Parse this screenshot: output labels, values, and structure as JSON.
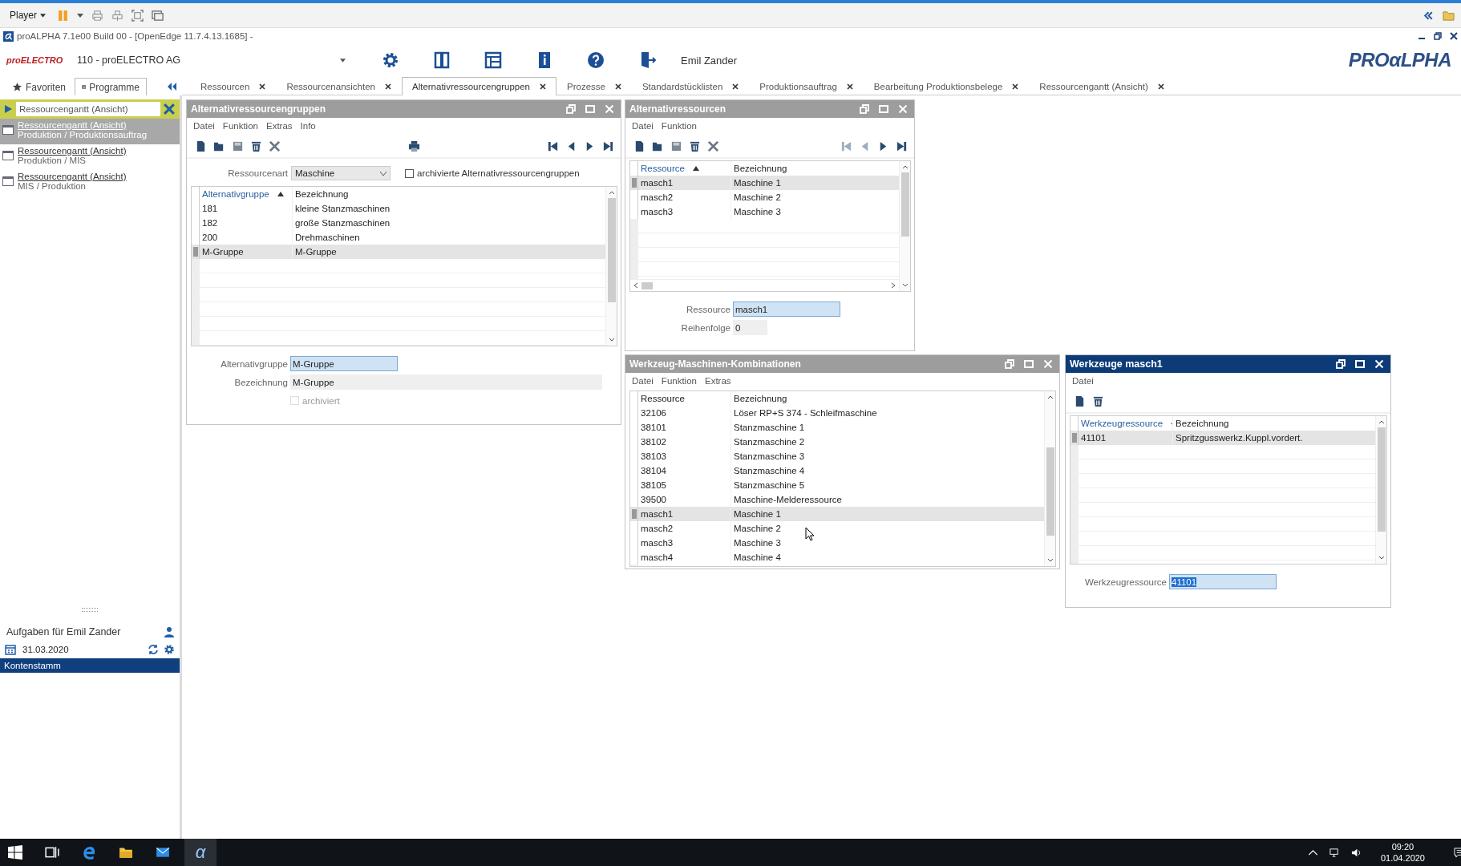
{
  "player_bar": {
    "menu": "Player"
  },
  "window": {
    "title": "proALPHA 7.1e00 Build 00 - [OpenEdge 11.7.4.13.1685] -"
  },
  "header": {
    "company_logo": "proELECTRO",
    "company": "110 - proELECTRO AG",
    "user": "Emil Zander",
    "brand_logo": "PROαLPHA"
  },
  "sidebar": {
    "tabs": [
      {
        "label": "Favoriten",
        "selected": false
      },
      {
        "label": "Programme",
        "selected": true
      }
    ],
    "search": {
      "value": "Ressourcengantt (Ansicht)"
    },
    "results": [
      {
        "title": "Ressourcengantt (Ansicht)",
        "path": "Produktion / Produktionsauftrag",
        "selected": true
      },
      {
        "title": "Ressourcengantt (Ansicht)",
        "path": "Produktion / MIS",
        "selected": false
      },
      {
        "title": "Ressourcengantt (Ansicht)",
        "path": "MIS / Produktion",
        "selected": false
      }
    ],
    "tasks": {
      "title": "Aufgaben für Emil Zander",
      "date": "31.03.2020",
      "items": [
        {
          "label": "Kontenstamm",
          "selected": true
        }
      ]
    }
  },
  "tabs": [
    {
      "label": "Ressourcen",
      "selected": false
    },
    {
      "label": "Ressourcenansichten",
      "selected": false
    },
    {
      "label": "Alternativressourcengruppen",
      "selected": true
    },
    {
      "label": "Prozesse",
      "selected": false
    },
    {
      "label": "Standardstücklisten",
      "selected": false
    },
    {
      "label": "Produktionsauftrag",
      "selected": false
    },
    {
      "label": "Bearbeitung Produktionsbelege",
      "selected": false
    },
    {
      "label": "Ressourcengantt (Ansicht)",
      "selected": false
    }
  ],
  "windows": [
    {
      "kind": "groups",
      "title": "Alternativressourcengruppen",
      "active": false,
      "menu": [
        "Datei",
        "Funktion",
        "Extras",
        "Info"
      ],
      "filter": {
        "label": "Ressourcenart",
        "value": "Maschine",
        "checkbox": {
          "label": "archivierte Alternativressourcengruppen",
          "checked": false
        }
      },
      "table": {
        "columns": [
          {
            "label": "Alternativgruppe",
            "sorted": true
          },
          {
            "label": "Bezeichnung",
            "sorted": false
          }
        ],
        "rows": [
          {
            "cells": [
              "181",
              "kleine Stanzmaschinen"
            ],
            "selected": false
          },
          {
            "cells": [
              "182",
              "große Stanzmaschinen"
            ],
            "selected": false
          },
          {
            "cells": [
              "200",
              "Drehmaschinen"
            ],
            "selected": false
          },
          {
            "cells": [
              "M-Gruppe",
              "M-Gruppe"
            ],
            "selected": true
          }
        ]
      },
      "fields": [
        {
          "kind": "input",
          "label": "Alternativgruppe",
          "value": "M-Gruppe",
          "text_selected": false
        },
        {
          "kind": "readonly",
          "label": "Bezeichnung",
          "value": "M-Gruppe"
        },
        {
          "kind": "checkbox",
          "label": "archiviert",
          "checked": false,
          "disabled": true
        }
      ]
    },
    {
      "kind": "resources",
      "title": "Alternativressourcen",
      "active": false,
      "menu": [
        "Datei",
        "Funktion"
      ],
      "table": {
        "columns": [
          {
            "label": "Ressource",
            "sorted": true
          },
          {
            "label": "Bezeichnung",
            "sorted": false
          }
        ],
        "rows": [
          {
            "cells": [
              "masch1",
              "Maschine 1"
            ],
            "selected": true
          },
          {
            "cells": [
              "masch2",
              "Maschine 2"
            ],
            "selected": false
          },
          {
            "cells": [
              "masch3",
              "Maschine 3"
            ],
            "selected": false
          }
        ]
      },
      "fields": [
        {
          "kind": "input",
          "label": "Ressource",
          "value": "masch1",
          "text_selected": false
        },
        {
          "kind": "readonly",
          "label": "Reihenfolge",
          "value": "0"
        }
      ]
    },
    {
      "kind": "combinations",
      "title": "Werkzeug-Maschinen-Kombinationen",
      "active": false,
      "menu": [
        "Datei",
        "Funktion",
        "Extras"
      ],
      "table": {
        "columns": [
          {
            "label": "Ressource",
            "sorted": false
          },
          {
            "label": "Bezeichnung",
            "sorted": false
          }
        ],
        "rows": [
          {
            "cells": [
              "32106",
              "Löser RP+S 374 - Schleifmaschine"
            ],
            "selected": false
          },
          {
            "cells": [
              "38101",
              "Stanzmaschine 1"
            ],
            "selected": false
          },
          {
            "cells": [
              "38102",
              "Stanzmaschine 2"
            ],
            "selected": false
          },
          {
            "cells": [
              "38103",
              "Stanzmaschine 3"
            ],
            "selected": false
          },
          {
            "cells": [
              "38104",
              "Stanzmaschine 4"
            ],
            "selected": false
          },
          {
            "cells": [
              "38105",
              "Stanzmaschine 5"
            ],
            "selected": false
          },
          {
            "cells": [
              "39500",
              "Maschine-Melderessource"
            ],
            "selected": false
          },
          {
            "cells": [
              "masch1",
              "Maschine 1"
            ],
            "selected": true
          },
          {
            "cells": [
              "masch2",
              "Maschine 2"
            ],
            "selected": false
          },
          {
            "cells": [
              "masch3",
              "Maschine 3"
            ],
            "selected": false
          },
          {
            "cells": [
              "masch4",
              "Maschine 4"
            ],
            "selected": false
          }
        ]
      }
    },
    {
      "kind": "tools",
      "title": "Werkzeuge masch1",
      "active": true,
      "menu": [
        "Datei"
      ],
      "table": {
        "columns": [
          {
            "label": "Werkzeugressource",
            "sorted": true
          },
          {
            "label": "Bezeichnung",
            "sorted": false
          }
        ],
        "rows": [
          {
            "cells": [
              "41101",
              "Spritzgusswerkz.Kuppl.vordert."
            ],
            "selected": true
          }
        ]
      },
      "fields": [
        {
          "kind": "input",
          "label": "Werkzeugressource",
          "value": "41101",
          "text_selected": true
        }
      ]
    }
  ],
  "taskbar": {
    "app_glyph": "α",
    "time": "09:20",
    "date": "01.04.2020"
  }
}
